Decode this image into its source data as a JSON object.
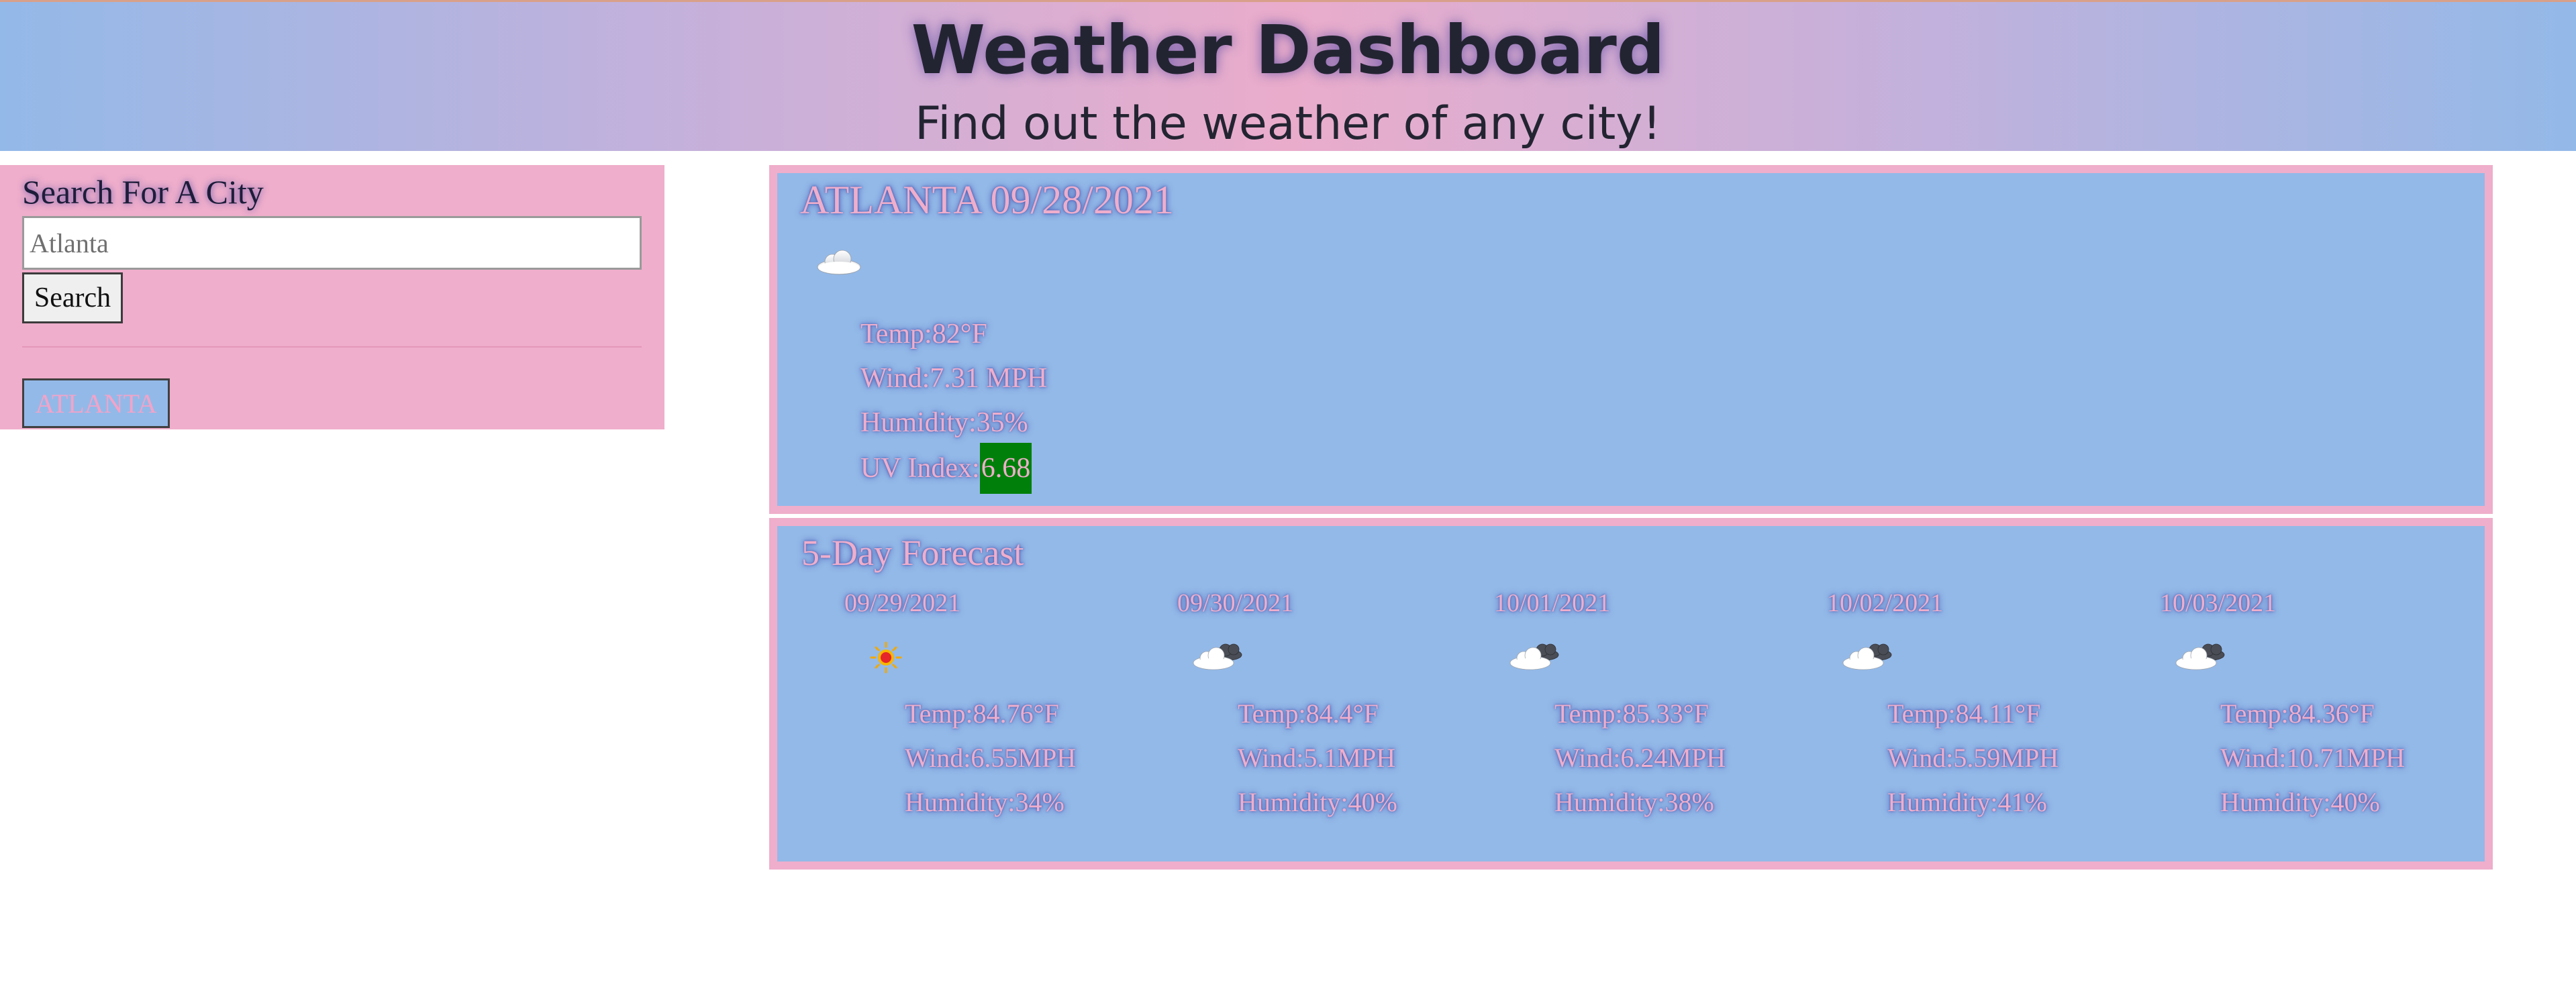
{
  "header": {
    "title": "Weather Dashboard",
    "subtitle": "Find out the weather of any city!"
  },
  "sidebar": {
    "heading": "Search For A City",
    "search_placeholder": "Atlanta",
    "search_value": "",
    "search_button": "Search",
    "history": [
      "ATLANTA"
    ]
  },
  "current": {
    "title": "ATLANTA 09/28/2021",
    "icon": "cloud-icon",
    "temp": "Temp:82°F",
    "wind": "Wind:7.31 MPH",
    "humidity": "Humidity:35%",
    "uv_label": "UV Index:",
    "uv_value": "6.68",
    "uv_color": "#00800a"
  },
  "forecast": {
    "title": "5-Day Forecast",
    "days": [
      {
        "date": "09/29/2021",
        "icon": "sun-icon",
        "temp": "Temp:84.76°F",
        "wind": "Wind:6.55MPH",
        "humidity": "Humidity:34%"
      },
      {
        "date": "09/30/2021",
        "icon": "cloud-icon",
        "temp": "Temp:84.4°F",
        "wind": "Wind:5.1MPH",
        "humidity": "Humidity:40%"
      },
      {
        "date": "10/01/2021",
        "icon": "cloud-icon",
        "temp": "Temp:85.33°F",
        "wind": "Wind:6.24MPH",
        "humidity": "Humidity:38%"
      },
      {
        "date": "10/02/2021",
        "icon": "cloud-icon",
        "temp": "Temp:84.11°F",
        "wind": "Wind:5.59MPH",
        "humidity": "Humidity:41%"
      },
      {
        "date": "10/03/2021",
        "icon": "cloud-icon",
        "temp": "Temp:84.36°F",
        "wind": "Wind:10.71MPH",
        "humidity": "Humidity:40%"
      }
    ]
  },
  "colors": {
    "pink": "#efaecb",
    "blue": "#93b9e8",
    "uv_green": "#00800a"
  }
}
